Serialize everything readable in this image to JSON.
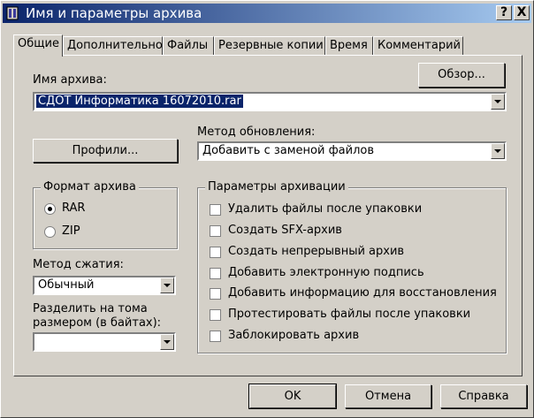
{
  "window": {
    "title": "Имя и параметры архива",
    "help_button": "?",
    "close_button": "X"
  },
  "tabs": [
    {
      "label": "Общие",
      "active": true
    },
    {
      "label": "Дополнительно",
      "active": false
    },
    {
      "label": "Файлы",
      "active": false
    },
    {
      "label": "Резервные копии",
      "active": false
    },
    {
      "label": "Время",
      "active": false
    },
    {
      "label": "Комментарий",
      "active": false
    }
  ],
  "archive_name": {
    "label": "Имя архива:",
    "value": "СДОТ Информатика 16072010.rar",
    "browse_label": "Обзор..."
  },
  "profiles": {
    "label": "Профили..."
  },
  "update_method": {
    "label": "Метод обновления:",
    "value": "Добавить с заменой файлов"
  },
  "archive_format": {
    "title": "Формат архива",
    "options": [
      {
        "label": "RAR",
        "checked": true
      },
      {
        "label": "ZIP",
        "checked": false
      }
    ]
  },
  "compression_method": {
    "label": "Метод сжатия:",
    "value": "Обычный"
  },
  "split_volumes": {
    "label_line1": "Разделить на тома",
    "label_line2": "размером (в байтах):",
    "value": ""
  },
  "archive_options": {
    "title": "Параметры архивации",
    "items": [
      {
        "label": "Удалить файлы после упаковки",
        "checked": false
      },
      {
        "label": "Создать SFX-архив",
        "checked": false
      },
      {
        "label": "Создать непрерывный архив",
        "checked": false
      },
      {
        "label": "Добавить электронную подпись",
        "checked": false
      },
      {
        "label": "Добавить информацию для восстановления",
        "checked": false
      },
      {
        "label": "Протестировать файлы после упаковки",
        "checked": false
      },
      {
        "label": "Заблокировать архив",
        "checked": false
      }
    ]
  },
  "footer": {
    "ok_label": "OK",
    "cancel_label": "Отмена",
    "help_label": "Справка"
  }
}
